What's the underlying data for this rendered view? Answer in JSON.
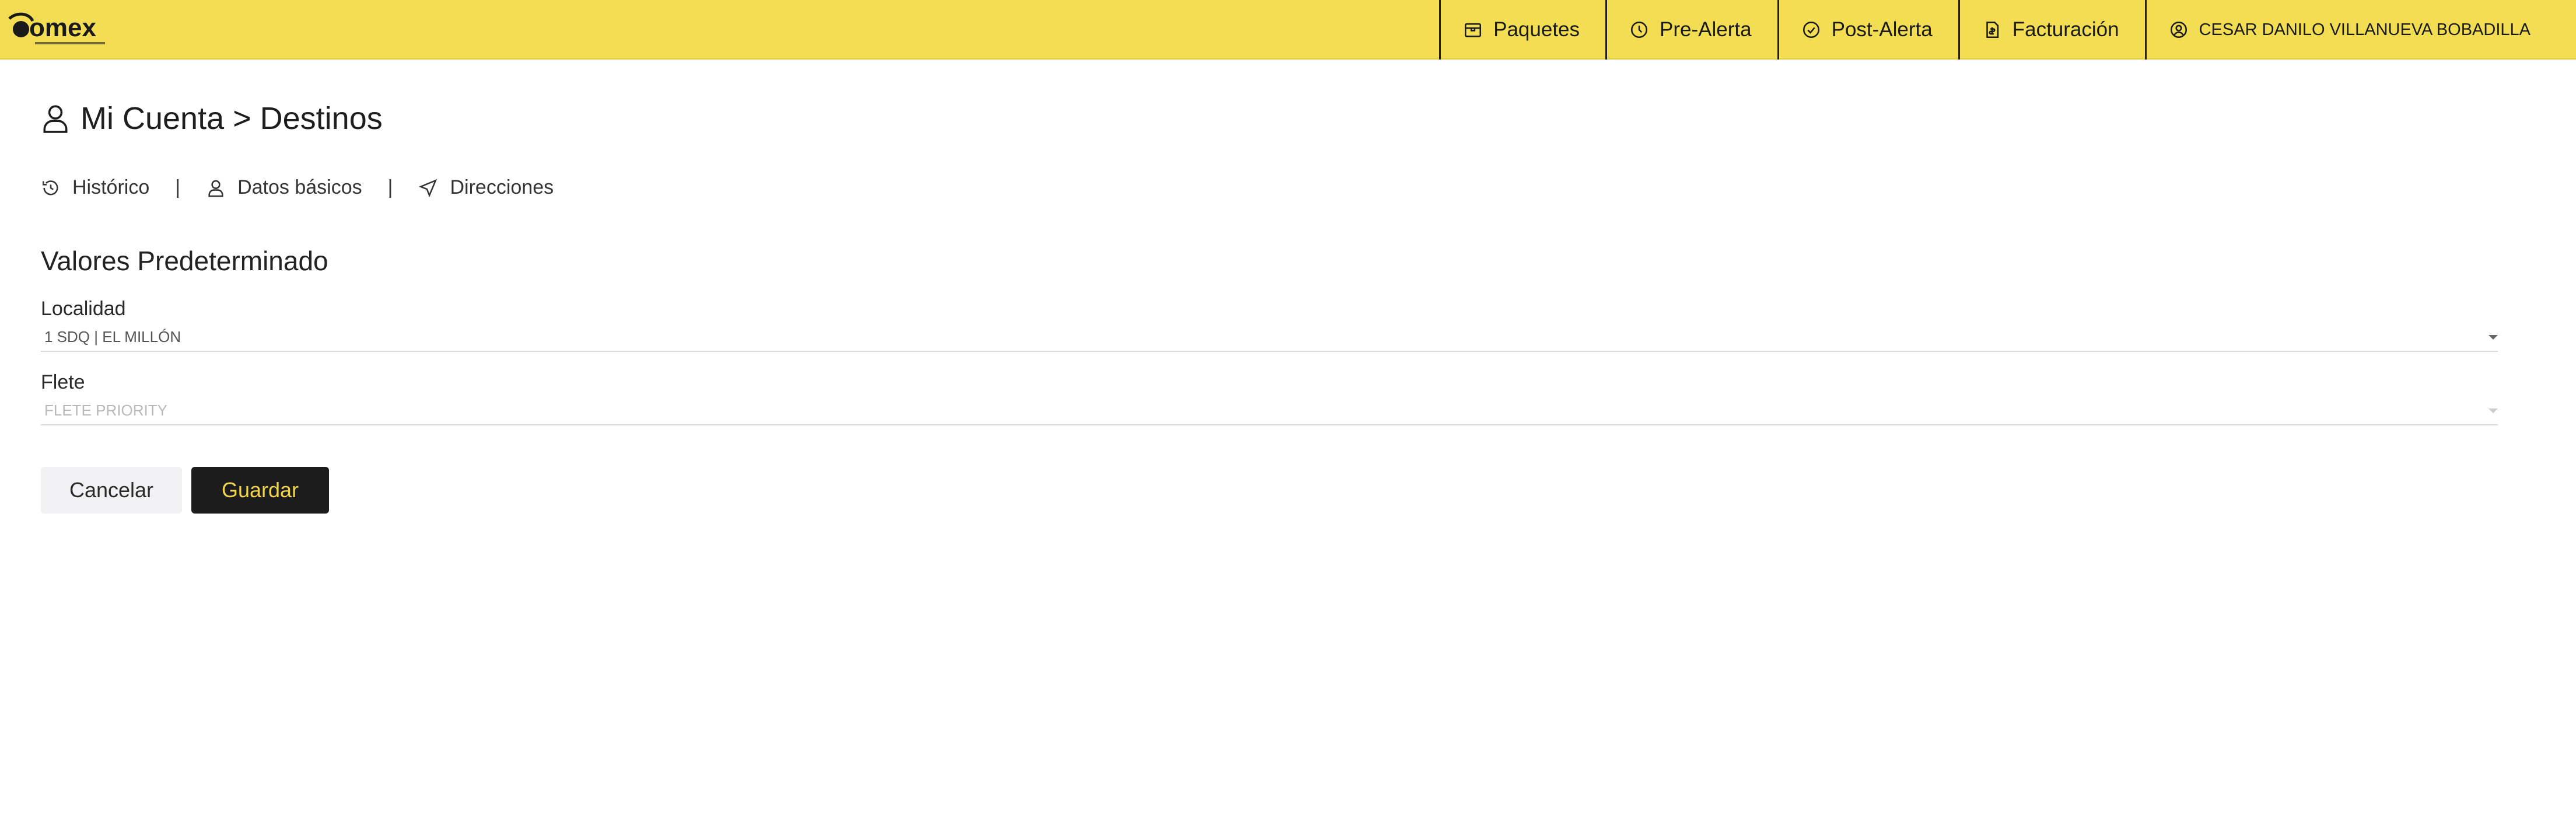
{
  "brand": {
    "logo_text": "Domex",
    "accent_color": "#f3dd53",
    "dark_color": "#1c1c1c"
  },
  "nav": {
    "items": [
      {
        "label": "Paquetes",
        "icon": "package-icon"
      },
      {
        "label": "Pre-Alerta",
        "icon": "clock-icon"
      },
      {
        "label": "Post-Alerta",
        "icon": "check-circle-icon"
      },
      {
        "label": "Facturación",
        "icon": "invoice-icon"
      }
    ],
    "user": {
      "label": "CESAR DANILO VILLANUEVA BOBADILLA",
      "icon": "user-circle-icon"
    }
  },
  "page": {
    "title": "Mi Cuenta > Destinos",
    "title_icon": "user-icon"
  },
  "subnav": {
    "items": [
      {
        "label": "Histórico",
        "icon": "history-icon"
      },
      {
        "label": "Datos básicos",
        "icon": "user-icon"
      },
      {
        "label": "Direcciones",
        "icon": "navigation-icon"
      }
    ],
    "separator": "|"
  },
  "form": {
    "section_title": "Valores Predeterminado",
    "localidad": {
      "label": "Localidad",
      "value": "1 SDQ | EL MILLÓN"
    },
    "flete": {
      "label": "Flete",
      "value": "FLETE PRIORITY"
    },
    "cancel_label": "Cancelar",
    "save_label": "Guardar"
  }
}
